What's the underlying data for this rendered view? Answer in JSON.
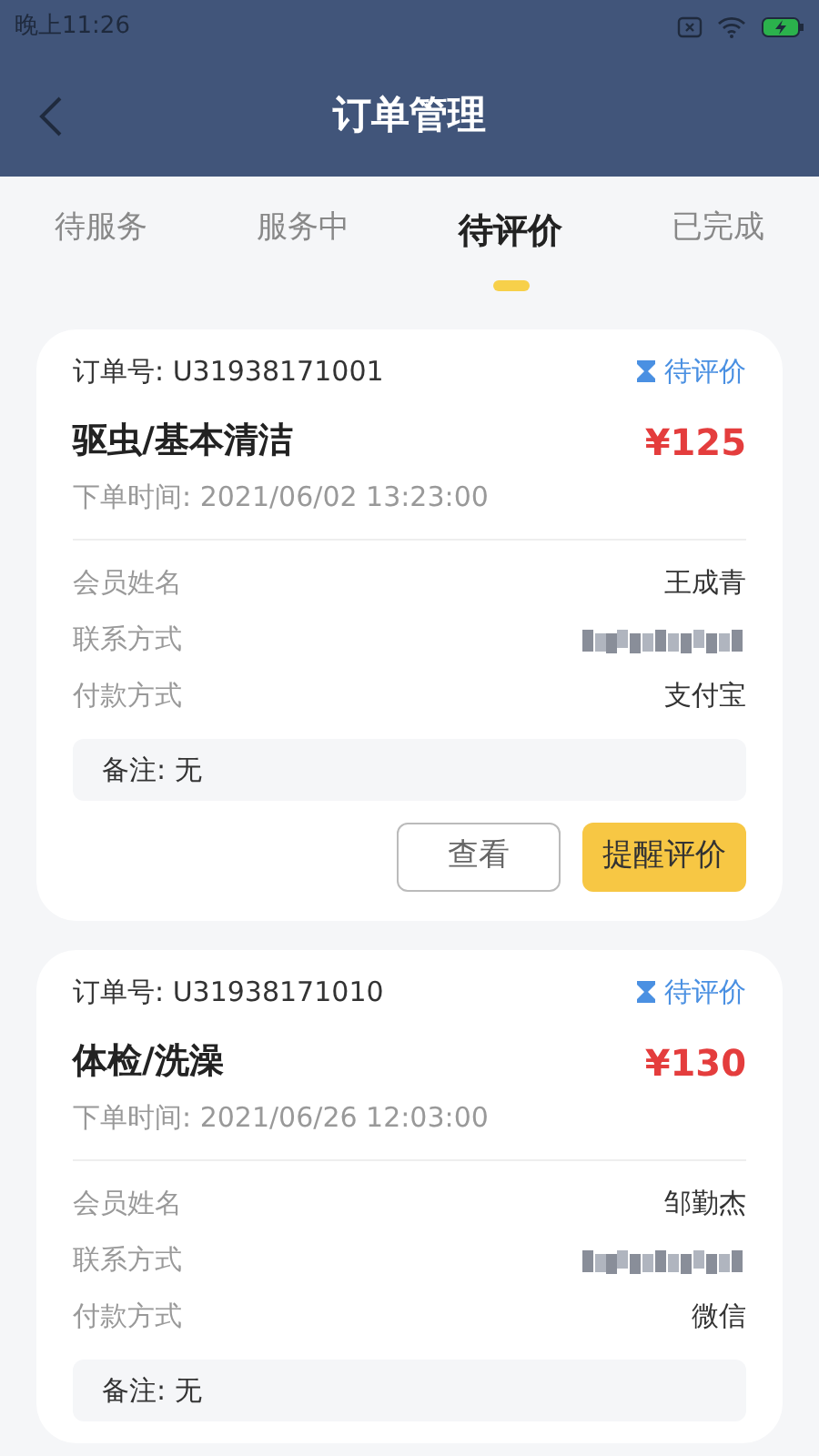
{
  "status_bar": {
    "time": "晚上11:26"
  },
  "header": {
    "title": "订单管理"
  },
  "tabs": [
    {
      "label": "待服务",
      "selected": false
    },
    {
      "label": "服务中",
      "selected": false
    },
    {
      "label": "待评价",
      "selected": true
    },
    {
      "label": "已完成",
      "selected": false
    }
  ],
  "orders": [
    {
      "order_no": "订单号: U31938171001",
      "status": "待评价",
      "service": "驱虫/基本清洁",
      "price": "¥125",
      "time": "下单时间: 2021/06/02 13:23:00",
      "fields": [
        {
          "kind": "text",
          "label": "会员姓名",
          "value": "王成青"
        },
        {
          "kind": "masked",
          "label": "联系方式"
        },
        {
          "kind": "text",
          "label": "付款方式",
          "value": "支付宝"
        }
      ],
      "note": "备注: 无",
      "actions": [
        {
          "kind": "outline",
          "label": "查看"
        },
        {
          "kind": "primary",
          "label": "提醒评价"
        }
      ]
    },
    {
      "order_no": "订单号: U31938171010",
      "status": "待评价",
      "service": "体检/洗澡",
      "price": "¥130",
      "time": "下单时间: 2021/06/26 12:03:00",
      "fields": [
        {
          "kind": "text",
          "label": "会员姓名",
          "value": "邹勤杰"
        },
        {
          "kind": "masked",
          "label": "联系方式"
        },
        {
          "kind": "text",
          "label": "付款方式",
          "value": "微信"
        }
      ],
      "note": "备注: 无"
    }
  ]
}
